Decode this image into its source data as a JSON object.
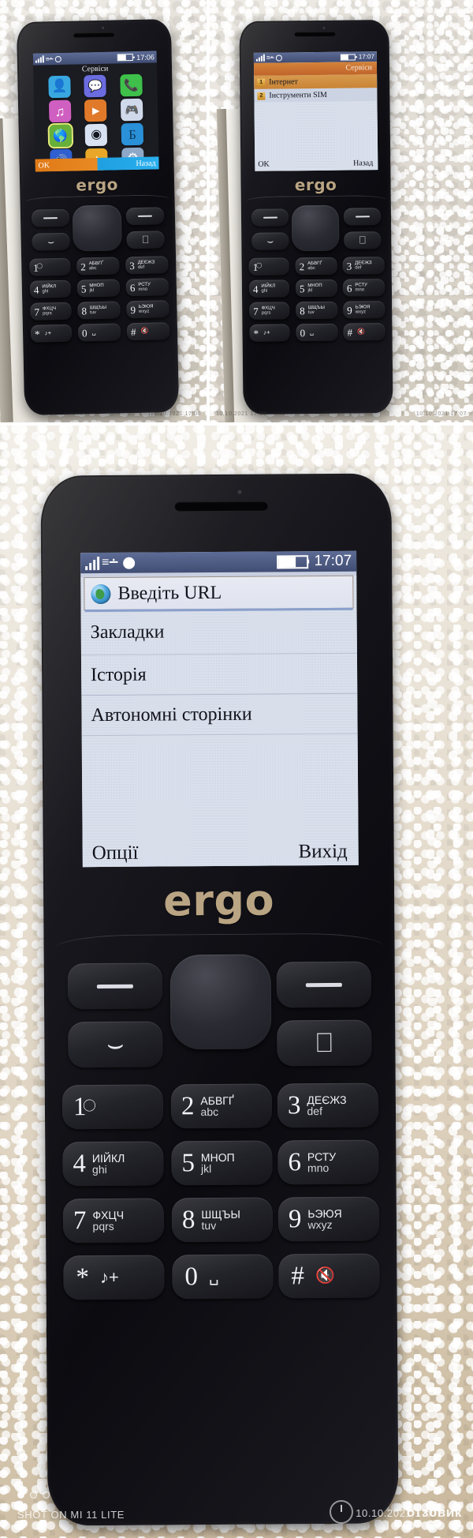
{
  "collage": {
    "photo_count": 3,
    "watermarks": {
      "top_left_photo_timestamp": "10.10.2021 17:06",
      "top_right_photo_timestamp": "10.10.2021 17:07",
      "bottom_photo_timestamp": "10.10.2021 17:07",
      "shot_on": "SHOT ON MI 11 LITE",
      "site_watermark": "отзовик"
    },
    "colors": {
      "statusbar": "#4a5678",
      "menu_header_orange": "#c8712f",
      "screen_bg": "#ccd4e4",
      "brand_text": "#b9a483",
      "selected_outline": "#e6ee78",
      "softkey_orange": "#e07a18",
      "softkey_blue": "#1f9fe0"
    }
  },
  "phone_brand": "ergo",
  "phone1": {
    "status": {
      "time": "17:06",
      "signal_bars": 4,
      "battery_pct": 55
    },
    "title": "Сервіси",
    "apps": [
      {
        "name": "contacts",
        "glyph": "👤",
        "bg": "#39a8e0"
      },
      {
        "name": "messages",
        "glyph": "💬",
        "bg": "#6b6ce0"
      },
      {
        "name": "call-log",
        "glyph": "📞",
        "bg": "#3ec04a"
      },
      {
        "name": "music",
        "glyph": "♫",
        "bg": "#cf5fc0"
      },
      {
        "name": "video",
        "glyph": "▶",
        "bg": "#e07a2a"
      },
      {
        "name": "games",
        "glyph": "🎮",
        "bg": "#cfd9ea"
      },
      {
        "name": "services",
        "glyph": "🌐",
        "bg": "#67b03a"
      },
      {
        "name": "camera",
        "glyph": "◉",
        "bg": "#d8e2f2"
      },
      {
        "name": "bank",
        "glyph": "Б",
        "bg": "#2a90d8"
      },
      {
        "name": "fm-radio",
        "glyph": "🔊",
        "bg": "#2f5fd0"
      },
      {
        "name": "calculator",
        "glyph": "±",
        "bg": "#e8a728"
      },
      {
        "name": "settings",
        "glyph": "⚙",
        "bg": "#8fa8c8"
      }
    ],
    "softkeys": {
      "left": "OK",
      "right": "Назад"
    }
  },
  "phone2": {
    "status": {
      "time": "17:07",
      "signal_bars": 4,
      "battery_pct": 55
    },
    "menu_title": "Сервіси",
    "items": [
      {
        "index": "1",
        "label": "Інтернет",
        "highlighted": true
      },
      {
        "index": "2",
        "label": "Інструменти SIM",
        "highlighted": false
      }
    ],
    "softkeys": {
      "left": "OK",
      "right": "Назад"
    }
  },
  "phone3": {
    "status": {
      "time": "17:07",
      "signal_bars": 4,
      "battery_pct": 60
    },
    "browser_menu": {
      "selected": {
        "label": "Введіть URL",
        "icon": "globe-icon"
      },
      "items": [
        "Закладки",
        "Історія",
        "Автономні сторінки"
      ]
    },
    "softkeys": {
      "left": "Опції",
      "right": "Вихід"
    }
  },
  "keypad": {
    "softkey_left": "soft-left-dash",
    "softkey_right": "soft-right-dash",
    "call_key": "call-icon",
    "end_key": "end-call-icon",
    "navigation": "dpad",
    "keys": [
      {
        "num": "1",
        "cyr": "",
        "lat": "",
        "extra": "voicemail-icon"
      },
      {
        "num": "2",
        "cyr": "АБВГҐ",
        "lat": "abc"
      },
      {
        "num": "3",
        "cyr": "ДЕЄЖЗ",
        "lat": "def"
      },
      {
        "num": "4",
        "cyr": "ИІЙКЛ",
        "lat": "ghi"
      },
      {
        "num": "5",
        "cyr": "МНОП",
        "lat": "jkl"
      },
      {
        "num": "6",
        "cyr": "РСТУ",
        "lat": "mno"
      },
      {
        "num": "7",
        "cyr": "ФХЦЧ",
        "lat": "pqrs"
      },
      {
        "num": "8",
        "cyr": "ШЩЪЫ",
        "lat": "tuv"
      },
      {
        "num": "9",
        "cyr": "ЬЭЮЯ",
        "lat": "wxyz"
      },
      {
        "num": "*",
        "cyr": "",
        "lat": "",
        "extra": "note-plus-icon"
      },
      {
        "num": "0",
        "cyr": "",
        "lat": "",
        "extra": "space-icon"
      },
      {
        "num": "#",
        "cyr": "",
        "lat": "",
        "extra": "silent-icon"
      }
    ]
  }
}
